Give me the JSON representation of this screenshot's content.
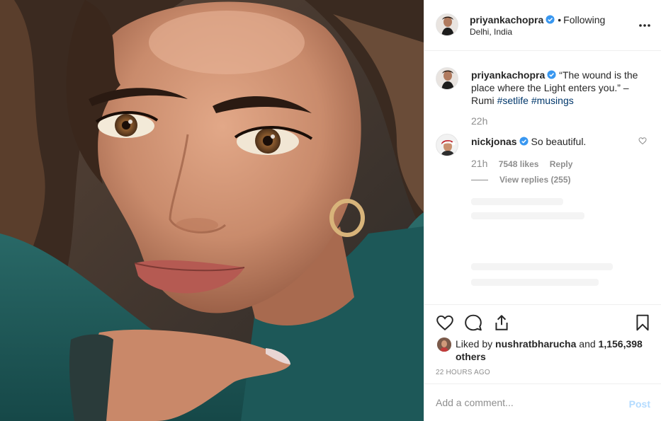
{
  "post": {
    "author": "priyankachopra",
    "follow_status": "Following",
    "location": "Delhi, India"
  },
  "caption": {
    "username": "priyankachopra",
    "text": "“The wound is the place where the Light enters you.” – Rumi",
    "tags": [
      "#setlife",
      "#musings"
    ],
    "time": "22h"
  },
  "comments": [
    {
      "username": "nickjonas",
      "text": "So beautiful.",
      "time": "21h",
      "likes": "7548 likes",
      "reply_label": "Reply",
      "view_replies": "View replies (255)"
    }
  ],
  "likes": {
    "prefix": "Liked by",
    "user": "nushratbharucha",
    "joiner": "and",
    "others": "1,156,398 others"
  },
  "timestamp": "22 HOURS AGO",
  "comment_box": {
    "placeholder": "Add a comment...",
    "post_label": "Post"
  },
  "icons": {
    "more": "more-options-icon",
    "like": "heart-icon",
    "comment": "comment-icon",
    "share": "share-icon",
    "save": "bookmark-icon",
    "verified": "verified-badge-icon"
  },
  "colors": {
    "verified": "#3897f0",
    "link": "#00376b",
    "muted": "#8e8e8e",
    "post_disabled": "#b3dbff",
    "sweater": "#1f5a5a"
  }
}
